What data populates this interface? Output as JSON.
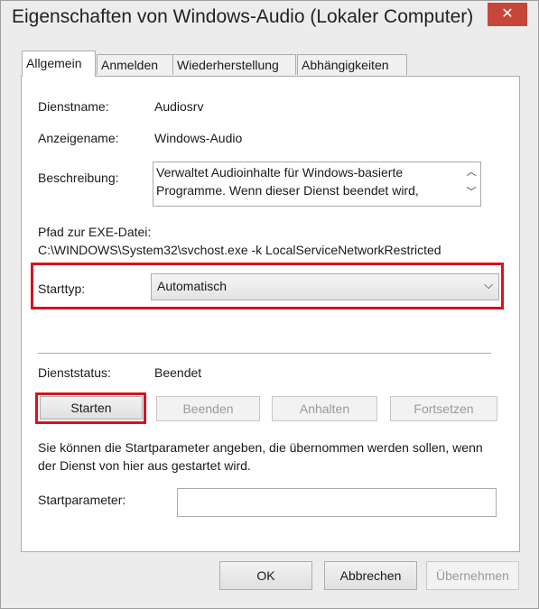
{
  "window": {
    "title": "Eigenschaften von Windows-Audio (Lokaler Computer)",
    "close_glyph": "✕"
  },
  "tabs": [
    {
      "label": "Allgemein",
      "active": true
    },
    {
      "label": "Anmelden"
    },
    {
      "label": "Wiederherstellung"
    },
    {
      "label": "Abhängigkeiten"
    }
  ],
  "general": {
    "service_name_label": "Dienstname:",
    "service_name": "Audiosrv",
    "display_name_label": "Anzeigename:",
    "display_name": "Windows-Audio",
    "description_label": "Beschreibung:",
    "description": "Verwaltet Audioinhalte für Windows-basierte Programme. Wenn dieser Dienst beendet wird,",
    "path_label": "Pfad zur EXE-Datei:",
    "path": "C:\\WINDOWS\\System32\\svchost.exe -k LocalServiceNetworkRestricted",
    "startup_type_label": "Starttyp:",
    "startup_type": "Automatisch",
    "status_label": "Dienststatus:",
    "status": "Beendet",
    "info": "Sie können die Startparameter angeben, die übernommen werden sollen, wenn der Dienst von hier aus gestartet wird.",
    "start_params_label": "Startparameter:",
    "start_params_value": ""
  },
  "service_buttons": {
    "start": "Starten",
    "stop": "Beenden",
    "pause": "Anhalten",
    "resume": "Fortsetzen"
  },
  "dialog_buttons": {
    "ok": "OK",
    "cancel": "Abbrechen",
    "apply": "Übernehmen"
  },
  "colors": {
    "highlight": "#d9121e",
    "close_button": "#c7463a"
  }
}
